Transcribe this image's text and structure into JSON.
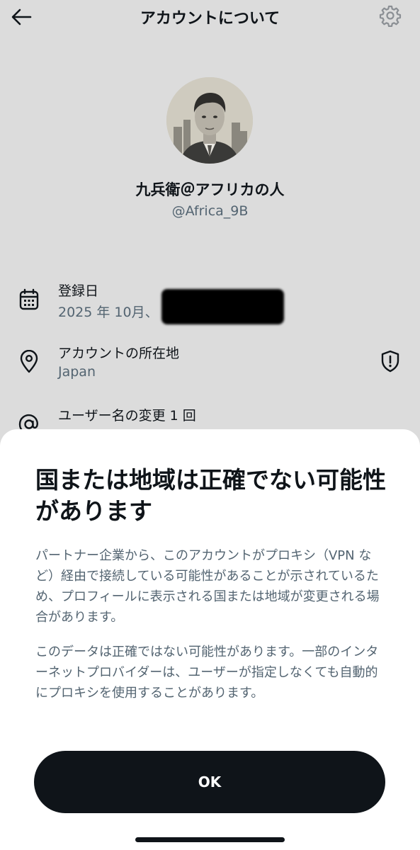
{
  "header": {
    "title": "アカウントについて",
    "back_icon": "arrow-left-icon",
    "settings_icon": "gear-icon"
  },
  "profile": {
    "display_name": "九兵衛＠アフリカの人",
    "handle": "@Africa_9B"
  },
  "info": {
    "joined": {
      "icon": "calendar-icon",
      "label": "登録日",
      "value": "2025 年 10月、"
    },
    "location": {
      "icon": "location-pin-icon",
      "label": "アカウントの所在地",
      "value": "Japan",
      "badge_icon": "shield-exclamation-icon"
    },
    "username_changes": {
      "icon": "at-sign-icon",
      "label": "ユーザー名の変更 1 回"
    }
  },
  "sheet": {
    "title": "国または地域は正確でない可能性があります",
    "paragraph1": "パートナー企業から、このアカウントがプロキシ（VPN など）経由で接続している可能性があることが示されているため、プロフィールに表示される国または地域が変更される場合があります。",
    "paragraph2": "このデータは正確ではない可能性があります。一部のインターネットプロバイダーは、ユーザーが指定しなくても自動的にプロキシを使用することがあります。",
    "ok_label": "OK"
  }
}
